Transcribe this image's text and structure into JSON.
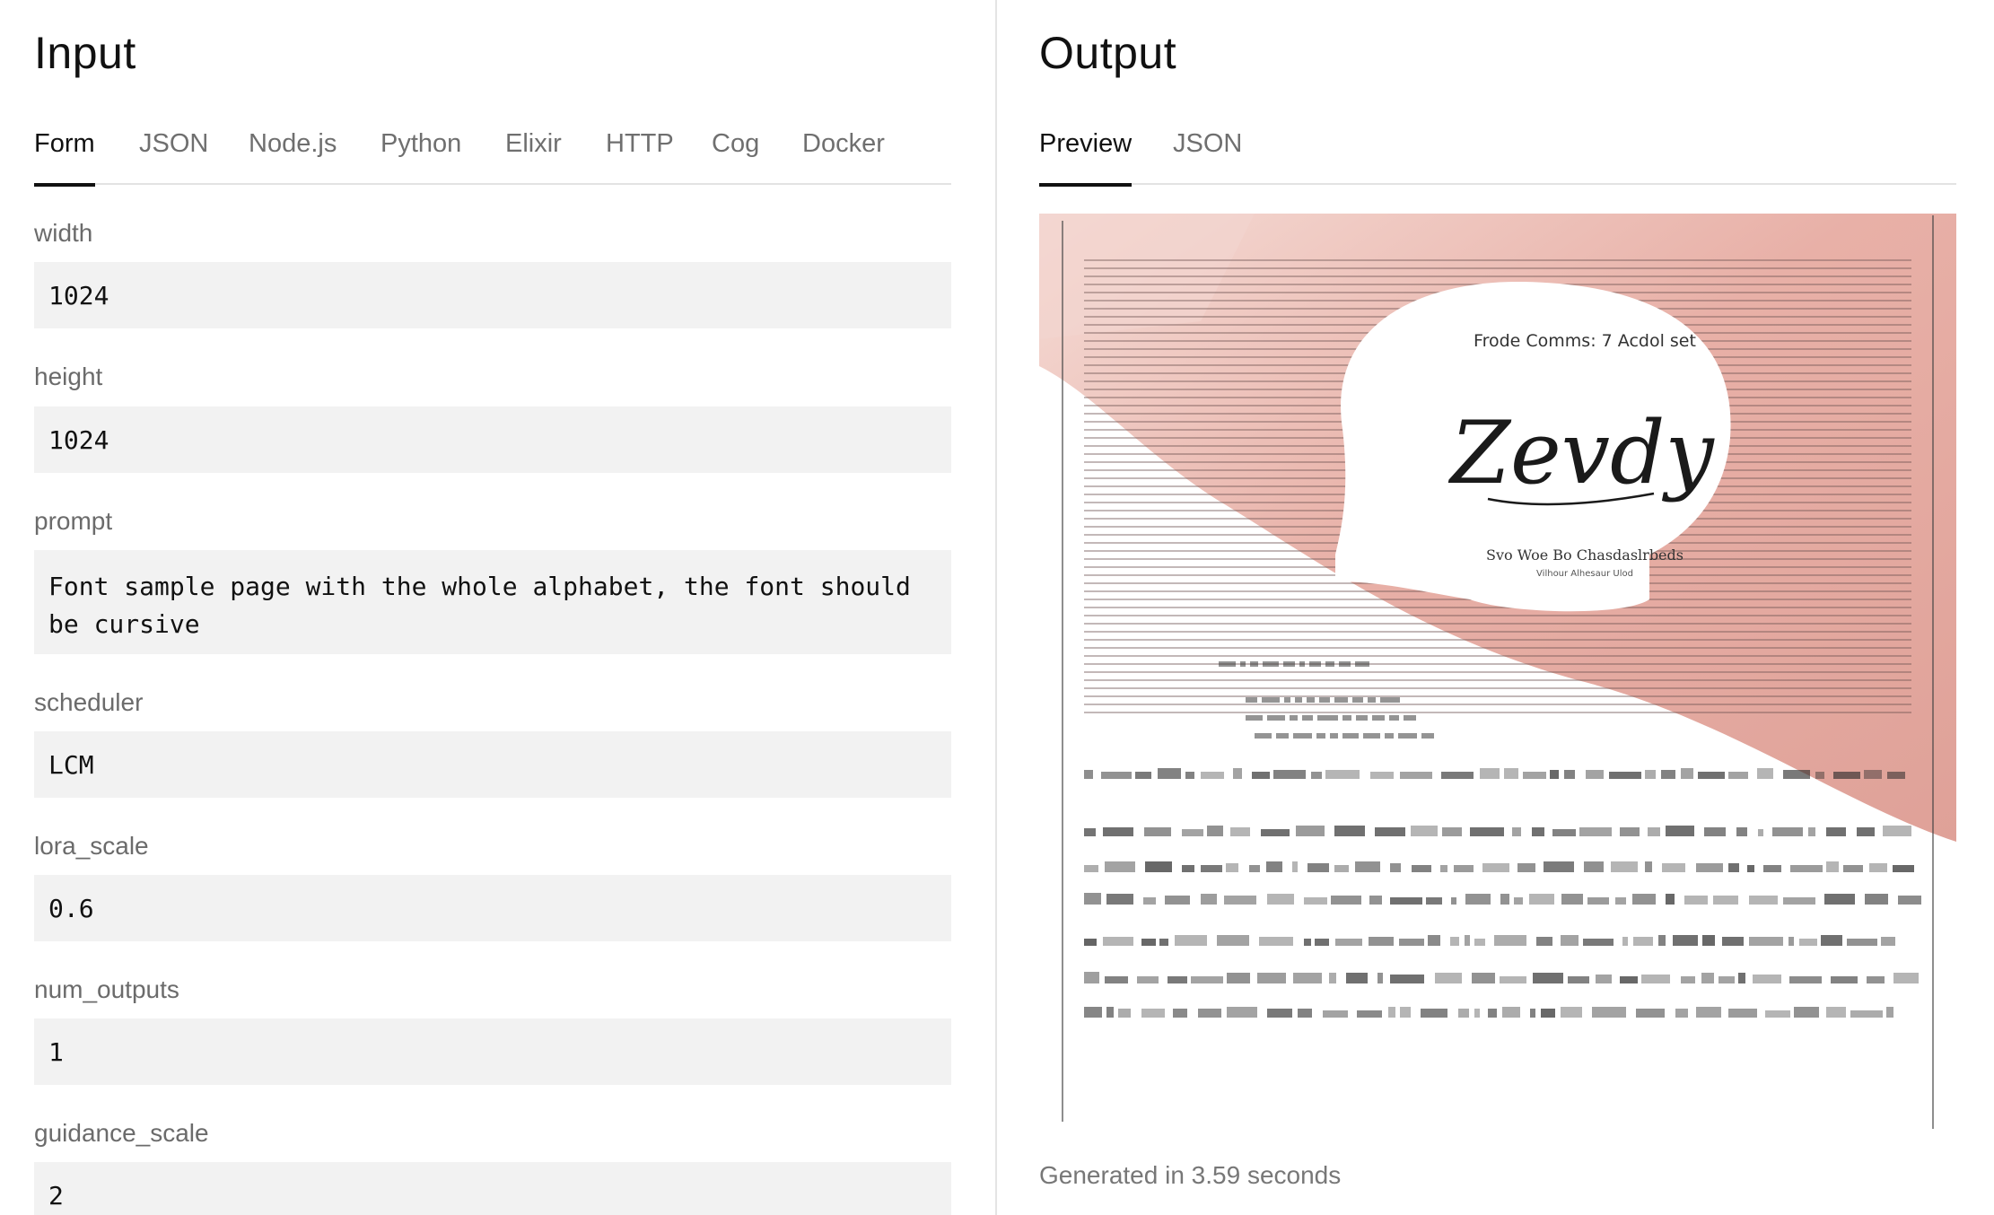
{
  "input": {
    "title": "Input",
    "tabs": [
      "Form",
      "JSON",
      "Node.js",
      "Python",
      "Elixir",
      "HTTP",
      "Cog",
      "Docker"
    ],
    "active_tab": "Form",
    "fields": {
      "width": {
        "label": "width",
        "value": "1024"
      },
      "height": {
        "label": "height",
        "value": "1024"
      },
      "prompt": {
        "label": "prompt",
        "value": "Font sample page with the whole alphabet, the font should be cursive"
      },
      "scheduler": {
        "label": "scheduler",
        "value": "LCM"
      },
      "lora_scale": {
        "label": "lora_scale",
        "value": "0.6"
      },
      "num_outputs": {
        "label": "num_outputs",
        "value": "1"
      },
      "guidance_scale": {
        "label": "guidance_scale",
        "value": "2"
      }
    }
  },
  "output": {
    "title": "Output",
    "tabs": [
      "Preview",
      "JSON"
    ],
    "active_tab": "Preview",
    "image": {
      "heading": "Frode Comms: 7 Acdol set",
      "script_word": "Zevdy",
      "subheading": "Svo Woe Bo Chasdaslrbeds",
      "subsub": "Vilhour Alhesaur Ulod",
      "background_color": "#e8b4ac",
      "paper_color": "#ffffff"
    },
    "caption": "Generated in 3.59 seconds"
  }
}
